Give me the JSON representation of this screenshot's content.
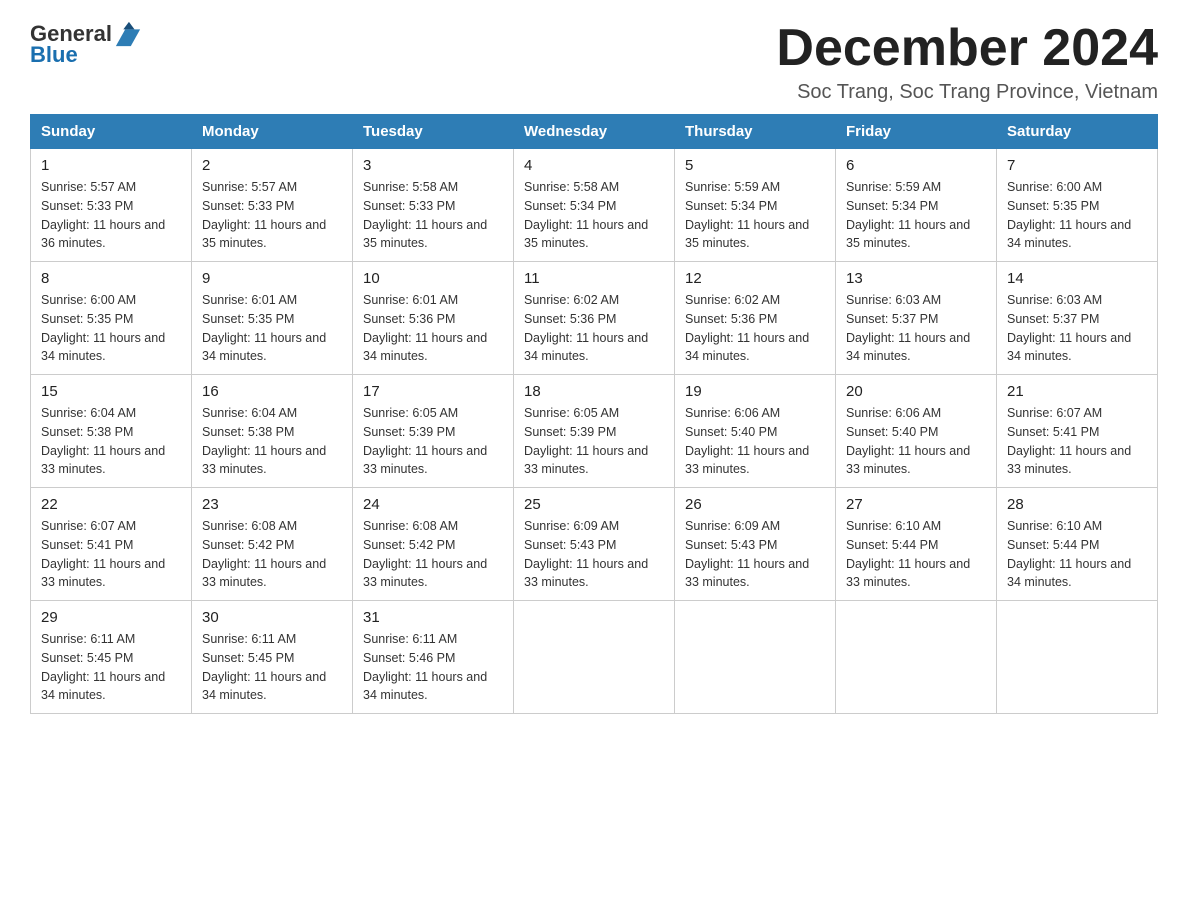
{
  "header": {
    "logo_general": "General",
    "logo_blue": "Blue",
    "month": "December 2024",
    "location": "Soc Trang, Soc Trang Province, Vietnam"
  },
  "days_of_week": [
    "Sunday",
    "Monday",
    "Tuesday",
    "Wednesday",
    "Thursday",
    "Friday",
    "Saturday"
  ],
  "weeks": [
    [
      {
        "day": "1",
        "sunrise": "5:57 AM",
        "sunset": "5:33 PM",
        "daylight": "11 hours and 36 minutes."
      },
      {
        "day": "2",
        "sunrise": "5:57 AM",
        "sunset": "5:33 PM",
        "daylight": "11 hours and 35 minutes."
      },
      {
        "day": "3",
        "sunrise": "5:58 AM",
        "sunset": "5:33 PM",
        "daylight": "11 hours and 35 minutes."
      },
      {
        "day": "4",
        "sunrise": "5:58 AM",
        "sunset": "5:34 PM",
        "daylight": "11 hours and 35 minutes."
      },
      {
        "day": "5",
        "sunrise": "5:59 AM",
        "sunset": "5:34 PM",
        "daylight": "11 hours and 35 minutes."
      },
      {
        "day": "6",
        "sunrise": "5:59 AM",
        "sunset": "5:34 PM",
        "daylight": "11 hours and 35 minutes."
      },
      {
        "day": "7",
        "sunrise": "6:00 AM",
        "sunset": "5:35 PM",
        "daylight": "11 hours and 34 minutes."
      }
    ],
    [
      {
        "day": "8",
        "sunrise": "6:00 AM",
        "sunset": "5:35 PM",
        "daylight": "11 hours and 34 minutes."
      },
      {
        "day": "9",
        "sunrise": "6:01 AM",
        "sunset": "5:35 PM",
        "daylight": "11 hours and 34 minutes."
      },
      {
        "day": "10",
        "sunrise": "6:01 AM",
        "sunset": "5:36 PM",
        "daylight": "11 hours and 34 minutes."
      },
      {
        "day": "11",
        "sunrise": "6:02 AM",
        "sunset": "5:36 PM",
        "daylight": "11 hours and 34 minutes."
      },
      {
        "day": "12",
        "sunrise": "6:02 AM",
        "sunset": "5:36 PM",
        "daylight": "11 hours and 34 minutes."
      },
      {
        "day": "13",
        "sunrise": "6:03 AM",
        "sunset": "5:37 PM",
        "daylight": "11 hours and 34 minutes."
      },
      {
        "day": "14",
        "sunrise": "6:03 AM",
        "sunset": "5:37 PM",
        "daylight": "11 hours and 34 minutes."
      }
    ],
    [
      {
        "day": "15",
        "sunrise": "6:04 AM",
        "sunset": "5:38 PM",
        "daylight": "11 hours and 33 minutes."
      },
      {
        "day": "16",
        "sunrise": "6:04 AM",
        "sunset": "5:38 PM",
        "daylight": "11 hours and 33 minutes."
      },
      {
        "day": "17",
        "sunrise": "6:05 AM",
        "sunset": "5:39 PM",
        "daylight": "11 hours and 33 minutes."
      },
      {
        "day": "18",
        "sunrise": "6:05 AM",
        "sunset": "5:39 PM",
        "daylight": "11 hours and 33 minutes."
      },
      {
        "day": "19",
        "sunrise": "6:06 AM",
        "sunset": "5:40 PM",
        "daylight": "11 hours and 33 minutes."
      },
      {
        "day": "20",
        "sunrise": "6:06 AM",
        "sunset": "5:40 PM",
        "daylight": "11 hours and 33 minutes."
      },
      {
        "day": "21",
        "sunrise": "6:07 AM",
        "sunset": "5:41 PM",
        "daylight": "11 hours and 33 minutes."
      }
    ],
    [
      {
        "day": "22",
        "sunrise": "6:07 AM",
        "sunset": "5:41 PM",
        "daylight": "11 hours and 33 minutes."
      },
      {
        "day": "23",
        "sunrise": "6:08 AM",
        "sunset": "5:42 PM",
        "daylight": "11 hours and 33 minutes."
      },
      {
        "day": "24",
        "sunrise": "6:08 AM",
        "sunset": "5:42 PM",
        "daylight": "11 hours and 33 minutes."
      },
      {
        "day": "25",
        "sunrise": "6:09 AM",
        "sunset": "5:43 PM",
        "daylight": "11 hours and 33 minutes."
      },
      {
        "day": "26",
        "sunrise": "6:09 AM",
        "sunset": "5:43 PM",
        "daylight": "11 hours and 33 minutes."
      },
      {
        "day": "27",
        "sunrise": "6:10 AM",
        "sunset": "5:44 PM",
        "daylight": "11 hours and 33 minutes."
      },
      {
        "day": "28",
        "sunrise": "6:10 AM",
        "sunset": "5:44 PM",
        "daylight": "11 hours and 34 minutes."
      }
    ],
    [
      {
        "day": "29",
        "sunrise": "6:11 AM",
        "sunset": "5:45 PM",
        "daylight": "11 hours and 34 minutes."
      },
      {
        "day": "30",
        "sunrise": "6:11 AM",
        "sunset": "5:45 PM",
        "daylight": "11 hours and 34 minutes."
      },
      {
        "day": "31",
        "sunrise": "6:11 AM",
        "sunset": "5:46 PM",
        "daylight": "11 hours and 34 minutes."
      },
      null,
      null,
      null,
      null
    ]
  ]
}
